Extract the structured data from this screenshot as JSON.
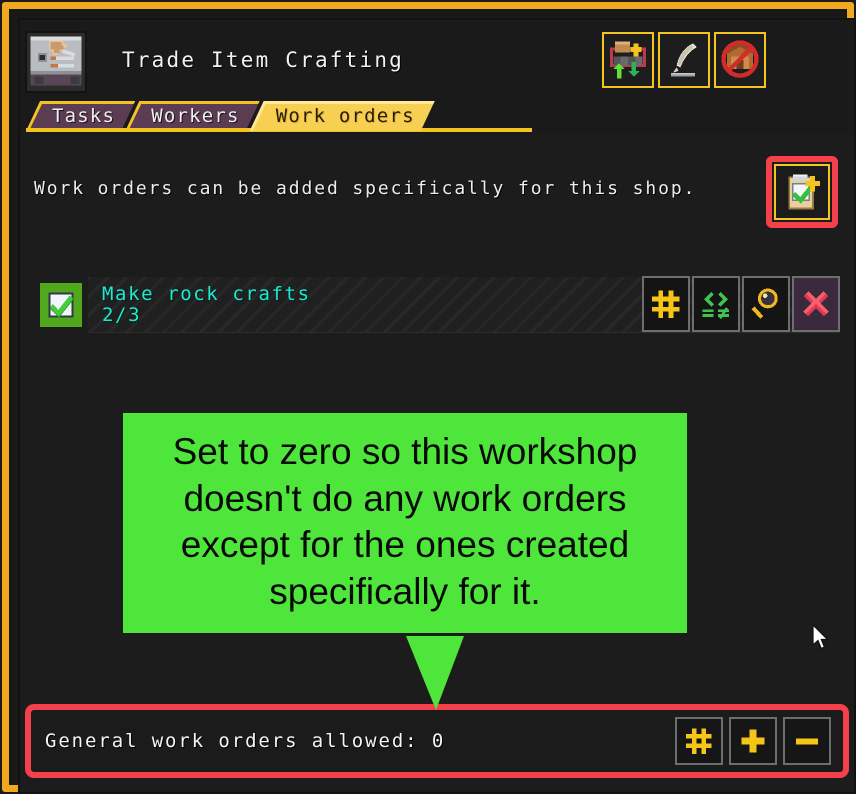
{
  "window": {
    "title": "Trade Item Crafting",
    "shop_icon": "craftsman-workshop-icon"
  },
  "header": {
    "tools": [
      {
        "name": "stockpile-links-icon",
        "label": ""
      },
      {
        "name": "quill-rename-icon",
        "label": ""
      },
      {
        "name": "no-building-icon",
        "label": ""
      }
    ]
  },
  "tabs": [
    {
      "label": "Tasks",
      "active": false
    },
    {
      "label": "Workers",
      "active": false
    },
    {
      "label": "Work orders",
      "active": true
    }
  ],
  "panel": {
    "description": "Work orders can be added specifically for this shop.",
    "add_order_icon": "clipboard-add-icon"
  },
  "orders": [
    {
      "checked": true,
      "name": "Make rock crafts",
      "count": "2/3",
      "actions": [
        {
          "name": "quantity-hash-icon"
        },
        {
          "name": "conditions-compare-icon"
        },
        {
          "name": "details-magnifier-icon"
        },
        {
          "name": "delete-x-icon"
        }
      ]
    }
  ],
  "general_bar": {
    "label": "General work orders allowed: 0",
    "value": "0",
    "actions": [
      {
        "name": "general-hash-icon"
      },
      {
        "name": "general-plus-icon"
      },
      {
        "name": "general-minus-icon"
      }
    ]
  },
  "annotation": {
    "text": "Set to zero so this workshop doesn't do any work orders except for the ones created specifically for it.",
    "bubble_color": "#4fe63b",
    "highlight_color": "#f4404a"
  },
  "colors": {
    "frame_gold": "#f0a91e",
    "tab_active": "#f7cf52",
    "tab_inactive": "#5b3c52",
    "order_text_cyan": "#1fe9cf",
    "background": "#1c1c1c"
  }
}
